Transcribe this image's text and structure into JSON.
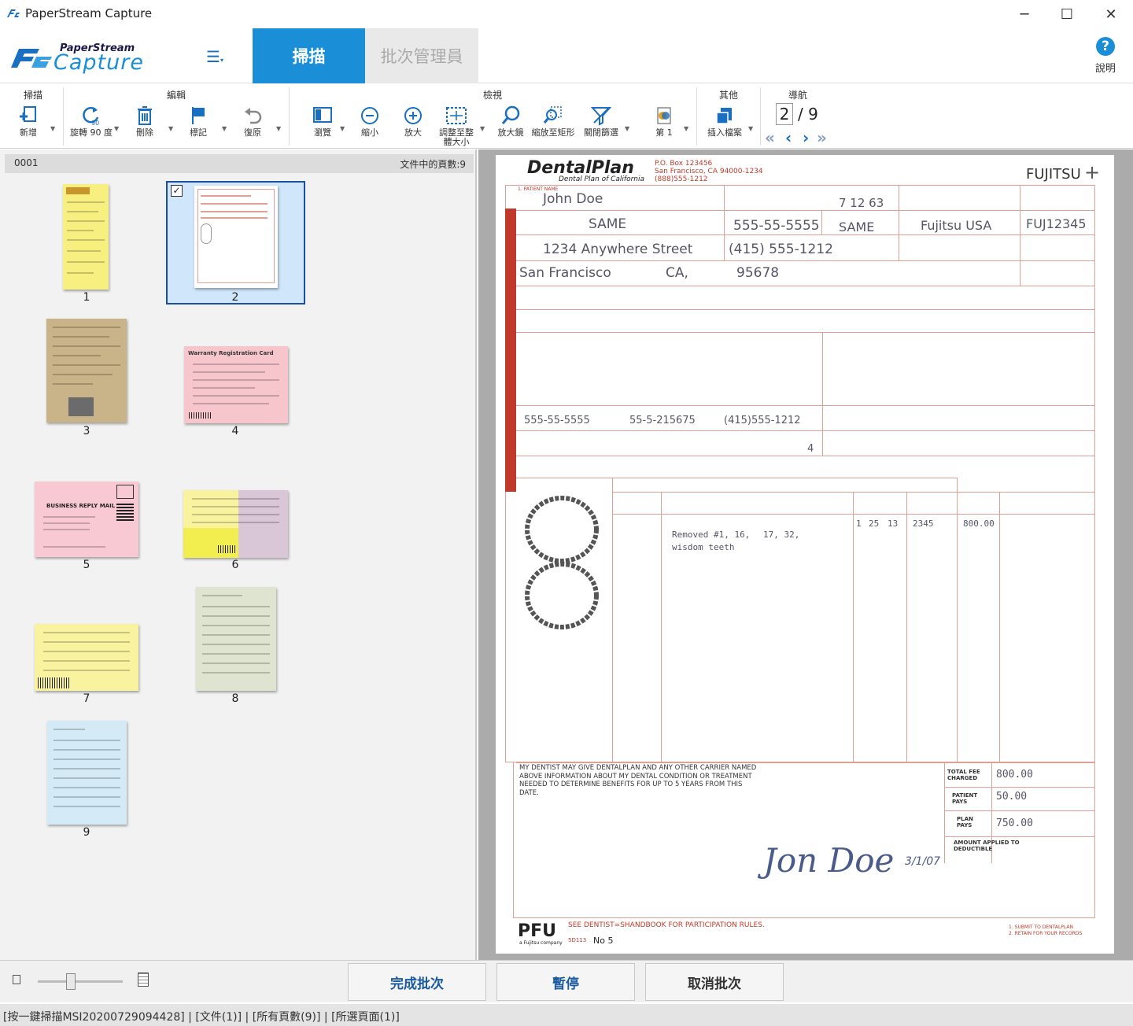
{
  "app": {
    "title": "PaperStream Capture",
    "logo_top": "PaperStream",
    "logo_bottom": "Capture",
    "accent": "#1a8fd8"
  },
  "tabs": [
    {
      "label": "掃描"
    },
    {
      "label": "批次管理員"
    }
  ],
  "help": {
    "label": "說明"
  },
  "ribbon": {
    "groups": {
      "scan": "掃描",
      "edit": "編輯",
      "view": "檢視",
      "other": "其他",
      "nav": "導航"
    },
    "buttons": {
      "add": "新增",
      "rotate": "旋轉 90 度",
      "delete": "刪除",
      "mark": "標記",
      "restore": "復原",
      "browse": "瀏覽",
      "zoom_out": "縮小",
      "zoom_in": "放大",
      "fit": "調整至整體大小",
      "magnifier": "放大鏡",
      "zoom_rect": "縮放至矩形",
      "close_filter": "關閉篩選",
      "page": "第 1",
      "insert": "插入檔案"
    },
    "nav": {
      "current": "2",
      "total": "/ 9"
    },
    "rotate_badge": "90"
  },
  "left_header": {
    "id": "0001",
    "count": "文件中的頁數:9"
  },
  "thumbnails": [
    {
      "num": "1",
      "color": "#f7ef80"
    },
    {
      "num": "2",
      "color": "#ffffff",
      "selected": true
    },
    {
      "num": "3",
      "color": "#c9b48a"
    },
    {
      "num": "4",
      "color": "#f7c6cc",
      "title": "Warranty Registration Card"
    },
    {
      "num": "5",
      "color": "#f9c9d3",
      "title": "BUSINESS REPLY MAIL"
    },
    {
      "num": "6",
      "color": "#f9f3a0"
    },
    {
      "num": "7",
      "color": "#f9f3a0"
    },
    {
      "num": "8",
      "color": "#dfe4d0"
    },
    {
      "num": "9",
      "color": "#d4ebf7"
    }
  ],
  "bottom": {
    "finish": "完成批次",
    "pause": "暫停",
    "cancel": "取消批次"
  },
  "status": "[按一鍵掃描MSI20200729094428] | [文件(1)] | [所有頁數(9)] | [所選頁面(1)]",
  "form": {
    "brand": "DentalPlan",
    "brand_sub": "Dental Plan of California",
    "addr1": "P.O. Box 123456",
    "addr2": "San Francisco, CA 94000-1234",
    "addr3": "(888)555-1212",
    "fujitsu": "FUJITSU",
    "patient_name_label": "1. PATIENT NAME",
    "patient_name": "John Doe",
    "birth": "7 12 63",
    "group_number": "FUJ12345",
    "employee_name": "SAME",
    "ssn": "555-55-5555",
    "emp_birth": "SAME",
    "employer": "Fujitsu  USA",
    "address": "1234 Anywhere Street",
    "phone": "(415) 555-1212",
    "city": "San Francisco",
    "state": "CA,",
    "zip": "95678",
    "dentist_ssn": "555-55-5555",
    "dentist_license": "55-5-215675",
    "dentist_phone": "(415)555-1212",
    "how_many": "4",
    "treatment1": "Removed #1, 16,",
    "treatment1b": "17, 32,",
    "treatment2": "wisdom teeth",
    "date_m": "1",
    "date_d": "25",
    "date_y": "13",
    "procedure": "2345",
    "fee": "800.00",
    "auth_text": "MY DENTIST MAY GIVE DENTALPLAN AND ANY OTHER CARRIER NAMED ABOVE INFORMATION ABOUT MY DENTAL CONDITION OR TREATMENT NEEDED TO DETERMINE BENEFITS FOR UP TO 5 YEARS FROM THIS DATE.",
    "total_fee_label": "TOTAL FEE CHARGED",
    "total_fee": "800.00",
    "patient_pays_label": "PATIENT PAYS",
    "patient_pays": "50.00",
    "plan_pays_label": "PLAN PAYS",
    "plan_pays": "750.00",
    "amount_applied": "AMOUNT APPLIED TO DEDUCTIBLE",
    "signature": "Jon Doe",
    "sign_date": "3/1/07",
    "pfu": "PFU",
    "pfu_sub": "a Fujitsu company",
    "footer_text": "SEE DENTIST=SHANDBOOK FOR PARTICIPATION RULES.",
    "footer_no": "No 5",
    "form_code": "5D113",
    "footer_right1": "1. SUBMIT TO DENTALPLAN",
    "footer_right2": "2. RETAIN FOR YOUR RECORDS"
  }
}
